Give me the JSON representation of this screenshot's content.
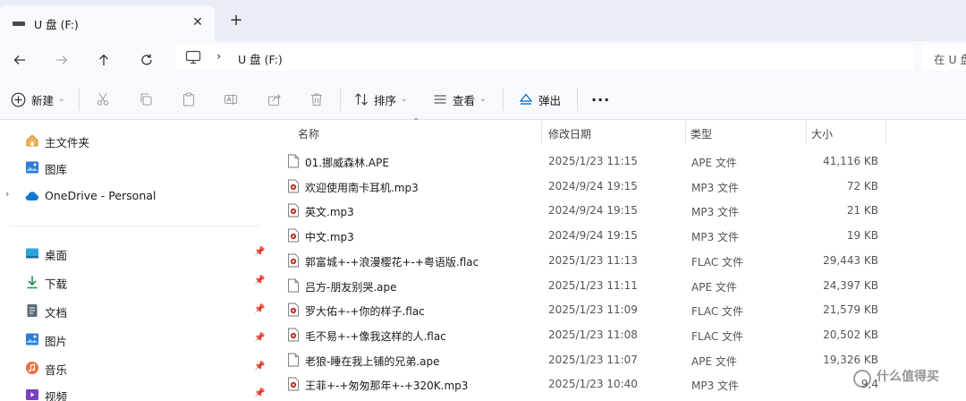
{
  "tab": {
    "title": "U 盘 (F:)",
    "close": "✕",
    "new": "+"
  },
  "address": {
    "path": "U 盘 (F:)",
    "separator": "›",
    "search_placeholder": "在 U 盘"
  },
  "commands": {
    "new": "新建",
    "sort": "排序",
    "view": "查看",
    "eject": "弹出",
    "more": "···"
  },
  "sidebar": {
    "home": "主文件夹",
    "gallery": "图库",
    "onedrive": "OneDrive - Personal",
    "desktop": "桌面",
    "downloads": "下载",
    "documents": "文档",
    "pictures": "图片",
    "music": "音乐",
    "videos": "视频"
  },
  "columns": {
    "name": "名称",
    "date": "修改日期",
    "type": "类型",
    "size": "大小"
  },
  "files": [
    {
      "name": "01.挪威森林.APE",
      "date": "2025/1/23 11:15",
      "type": "APE 文件",
      "size": "41,116 KB",
      "icon": "document-icon"
    },
    {
      "name": "欢迎使用南卡耳机.mp3",
      "date": "2024/9/24 19:15",
      "type": "MP3 文件",
      "size": "72 KB",
      "icon": "audio-file-icon"
    },
    {
      "name": "英文.mp3",
      "date": "2024/9/24 19:15",
      "type": "MP3 文件",
      "size": "21 KB",
      "icon": "audio-file-icon"
    },
    {
      "name": "中文.mp3",
      "date": "2024/9/24 19:15",
      "type": "MP3 文件",
      "size": "19 KB",
      "icon": "audio-file-icon"
    },
    {
      "name": "郭富城+-+浪漫樱花+-+粤语版.flac",
      "date": "2025/1/23 11:13",
      "type": "FLAC 文件",
      "size": "29,443 KB",
      "icon": "audio-file-icon"
    },
    {
      "name": "吕方-朋友别哭.ape",
      "date": "2025/1/23 11:11",
      "type": "APE 文件",
      "size": "24,397 KB",
      "icon": "document-icon"
    },
    {
      "name": "罗大佑+-+你的样子.flac",
      "date": "2025/1/23 11:09",
      "type": "FLAC 文件",
      "size": "21,579 KB",
      "icon": "audio-file-icon"
    },
    {
      "name": "毛不易+-+像我这样的人.flac",
      "date": "2025/1/23 11:08",
      "type": "FLAC 文件",
      "size": "20,502 KB",
      "icon": "audio-file-icon"
    },
    {
      "name": "老狼-睡在我上铺的兄弟.ape",
      "date": "2025/1/23 11:07",
      "type": "APE 文件",
      "size": "19,326 KB",
      "icon": "document-icon"
    },
    {
      "name": "王菲+-+匆匆那年+-+320K.mp3",
      "date": "2025/1/23 10:40",
      "type": "MP3 文件",
      "size": "9,4",
      "icon": "audio-file-icon"
    }
  ],
  "watermark": "什么值得买"
}
